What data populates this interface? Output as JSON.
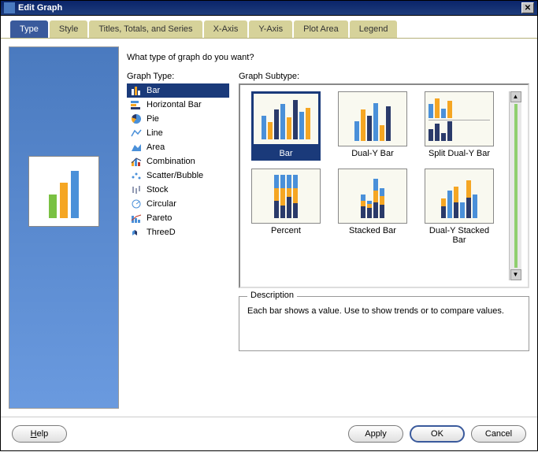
{
  "window": {
    "title": "Edit Graph"
  },
  "tabs": [
    {
      "label": "Type"
    },
    {
      "label": "Style"
    },
    {
      "label": "Titles, Totals, and Series"
    },
    {
      "label": "X-Axis"
    },
    {
      "label": "Y-Axis"
    },
    {
      "label": "Plot Area"
    },
    {
      "label": "Legend"
    }
  ],
  "question": "What type of graph do you want?",
  "labels": {
    "graph_type": "Graph Type:",
    "graph_subtype": "Graph Subtype:",
    "description": "Description"
  },
  "graph_types": [
    {
      "name": "Bar"
    },
    {
      "name": "Horizontal Bar"
    },
    {
      "name": "Pie"
    },
    {
      "name": "Line"
    },
    {
      "name": "Area"
    },
    {
      "name": "Combination"
    },
    {
      "name": "Scatter/Bubble"
    },
    {
      "name": "Stock"
    },
    {
      "name": "Circular"
    },
    {
      "name": "Pareto"
    },
    {
      "name": "ThreeD"
    }
  ],
  "subtypes": [
    {
      "name": "Bar"
    },
    {
      "name": "Dual-Y Bar"
    },
    {
      "name": "Split Dual-Y Bar"
    },
    {
      "name": "Percent"
    },
    {
      "name": "Stacked Bar"
    },
    {
      "name": "Dual-Y Stacked Bar"
    }
  ],
  "description_text": "Each bar shows a value. Use to show trends or to compare values.",
  "buttons": {
    "help": "Help",
    "apply": "Apply",
    "ok": "OK",
    "cancel": "Cancel"
  }
}
